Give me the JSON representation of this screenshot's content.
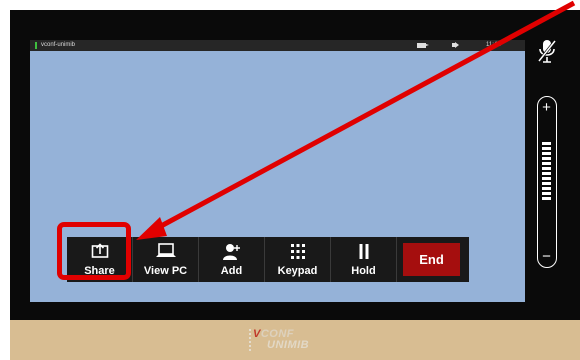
{
  "header": {
    "room_name": "vconf-unimib",
    "time": "11:42",
    "icons": [
      "camera-icon",
      "speaker-icon"
    ]
  },
  "call_controls": {
    "share": "Share",
    "view_pc": "View PC",
    "add": "Add",
    "keypad": "Keypad",
    "hold": "Hold",
    "end": "End"
  },
  "side_panel": {
    "mic_icon": "mic-muted-icon",
    "volume_plus": "+",
    "volume_minus": "−",
    "volume_level": 12
  },
  "logo": {
    "line1_accent": "V",
    "line1_rest": "CONF",
    "line2": "UNIMIB"
  },
  "colors": {
    "screen_bg": "#95b2d8",
    "end_button": "#a50e0e",
    "annotation": "#e00000",
    "bezel_bottom": "#d8bd92"
  }
}
